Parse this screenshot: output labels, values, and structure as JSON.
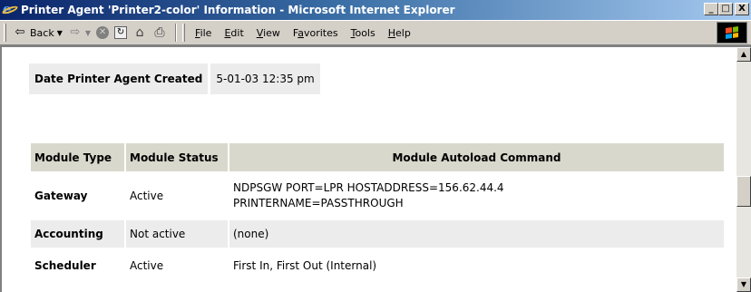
{
  "window": {
    "title": "Printer Agent 'Printer2-color' Information - Microsoft Internet Explorer",
    "minimize": "_",
    "maximize": "□",
    "close": "X"
  },
  "toolbar": {
    "back_label": "Back",
    "back_icon": "⇦",
    "forward_icon": "⇨",
    "stop_icon": "✕",
    "refresh_icon": "↻",
    "home_icon": "⌂",
    "print_icon": "⎙"
  },
  "menu": {
    "items": [
      {
        "pre": "",
        "key": "F",
        "post": "ile"
      },
      {
        "pre": "",
        "key": "E",
        "post": "dit"
      },
      {
        "pre": "",
        "key": "V",
        "post": "iew"
      },
      {
        "pre": "F",
        "key": "a",
        "post": "vorites"
      },
      {
        "pre": "",
        "key": "T",
        "post": "ools"
      },
      {
        "pre": "",
        "key": "H",
        "post": "elp"
      }
    ]
  },
  "page": {
    "date_label": "Date Printer Agent Created",
    "date_value": "5-01-03 12:35 pm",
    "columns": [
      "Module Type",
      "Module Status",
      "Module Autoload Command"
    ],
    "rows": [
      {
        "type": "Gateway",
        "status": "Active",
        "command_line1": "NDPSGW PORT=LPR HOSTADDRESS=156.62.44.4",
        "command_line2": "PRINTERNAME=PASSTHROUGH"
      },
      {
        "type": "Accounting",
        "status": "Not active",
        "command_line1": "(none)",
        "command_line2": ""
      },
      {
        "type": "Scheduler",
        "status": "Active",
        "command_line1": "First In, First Out (Internal)",
        "command_line2": ""
      }
    ]
  },
  "colors": {
    "titlebar_start": "#0a246a",
    "titlebar_end": "#a6caf0",
    "header_bg": "#d8d8cc",
    "alt_row_bg": "#ececec"
  }
}
